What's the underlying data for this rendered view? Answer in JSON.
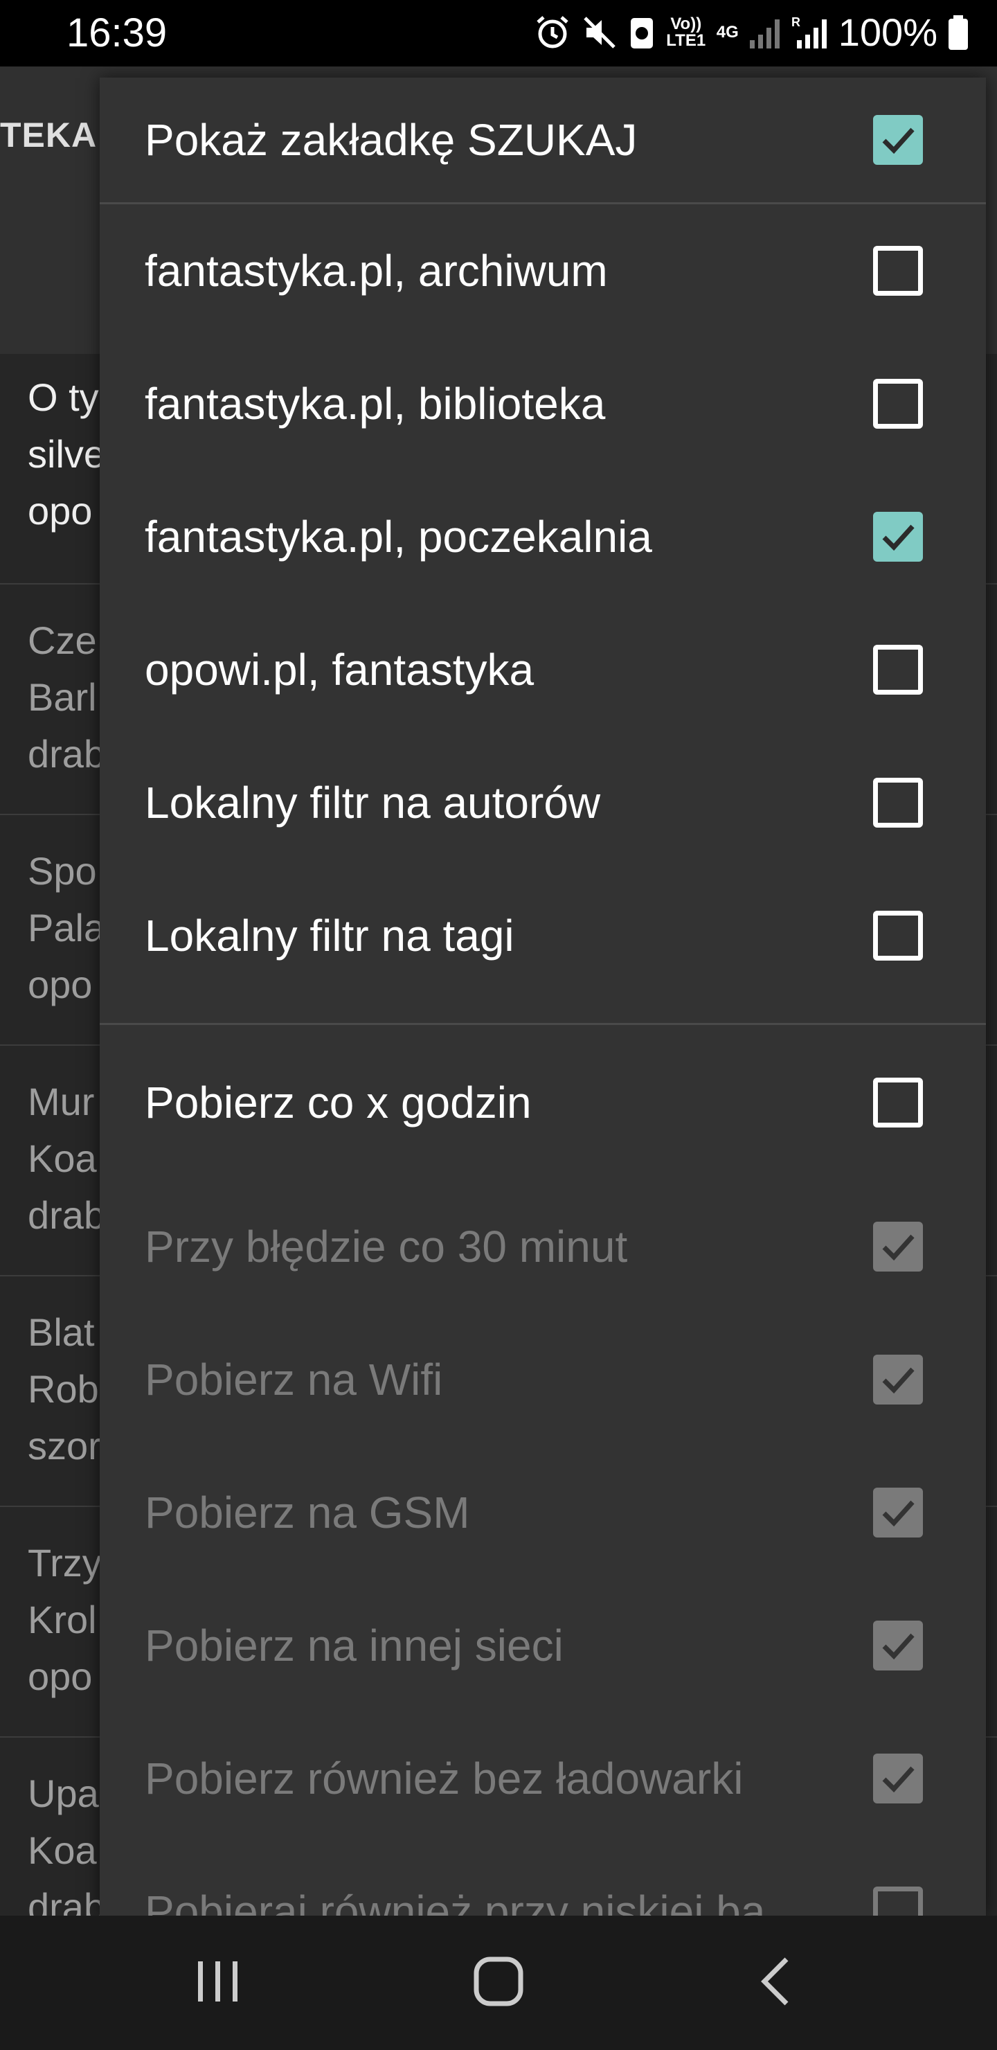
{
  "status_bar": {
    "time": "16:39",
    "volte_label": "Vo)) LTE1",
    "network_label": "4G",
    "roaming_label": "R",
    "battery": "100%"
  },
  "background_app": {
    "tab_label": "TEKA",
    "items": [
      {
        "lines": [
          "O ty",
          "silve",
          "opo"
        ]
      },
      {
        "lines": [
          "Cze",
          "Barl",
          "drab"
        ]
      },
      {
        "lines": [
          "Spo",
          "Pala",
          "opo"
        ]
      },
      {
        "lines": [
          "Mur",
          "Koa",
          "drab"
        ]
      },
      {
        "lines": [
          "Blat",
          "Rob",
          "szor"
        ]
      },
      {
        "lines": [
          "Trzy",
          "Krol",
          "opo"
        ]
      },
      {
        "lines": [
          "Upa",
          "Koa",
          "drab"
        ]
      }
    ]
  },
  "menu": {
    "items": [
      {
        "label": "Pokaż zakładkę SZUKAJ",
        "checked": true,
        "enabled": true
      },
      {
        "label": "fantastyka.pl, archiwum",
        "checked": false,
        "enabled": true
      },
      {
        "label": "fantastyka.pl, biblioteka",
        "checked": false,
        "enabled": true
      },
      {
        "label": "fantastyka.pl, poczekalnia",
        "checked": true,
        "enabled": true
      },
      {
        "label": "opowi.pl, fantastyka",
        "checked": false,
        "enabled": true
      },
      {
        "label": "Lokalny filtr na autorów",
        "checked": false,
        "enabled": true
      },
      {
        "label": "Lokalny filtr na tagi",
        "checked": false,
        "enabled": true
      },
      {
        "label": "Pobierz co x godzin",
        "checked": false,
        "enabled": true
      },
      {
        "label": "Przy błędzie co 30 minut",
        "checked": true,
        "enabled": false
      },
      {
        "label": "Pobierz na Wifi",
        "checked": true,
        "enabled": false
      },
      {
        "label": "Pobierz na GSM",
        "checked": true,
        "enabled": false
      },
      {
        "label": "Pobierz na innej sieci",
        "checked": true,
        "enabled": false
      },
      {
        "label": "Pobierz również bez ładowarki",
        "checked": true,
        "enabled": false
      },
      {
        "label": "Pobierai również przy niskiei ba...",
        "checked": false,
        "enabled": false
      }
    ]
  },
  "nav_bar": {
    "recents_icon": "recents-icon",
    "home_icon": "home-icon",
    "back_icon": "back-icon"
  },
  "colors": {
    "checkbox_checked": "#80cbc4",
    "menu_bg": "#333333",
    "disabled_text": "#7a7a7a"
  }
}
